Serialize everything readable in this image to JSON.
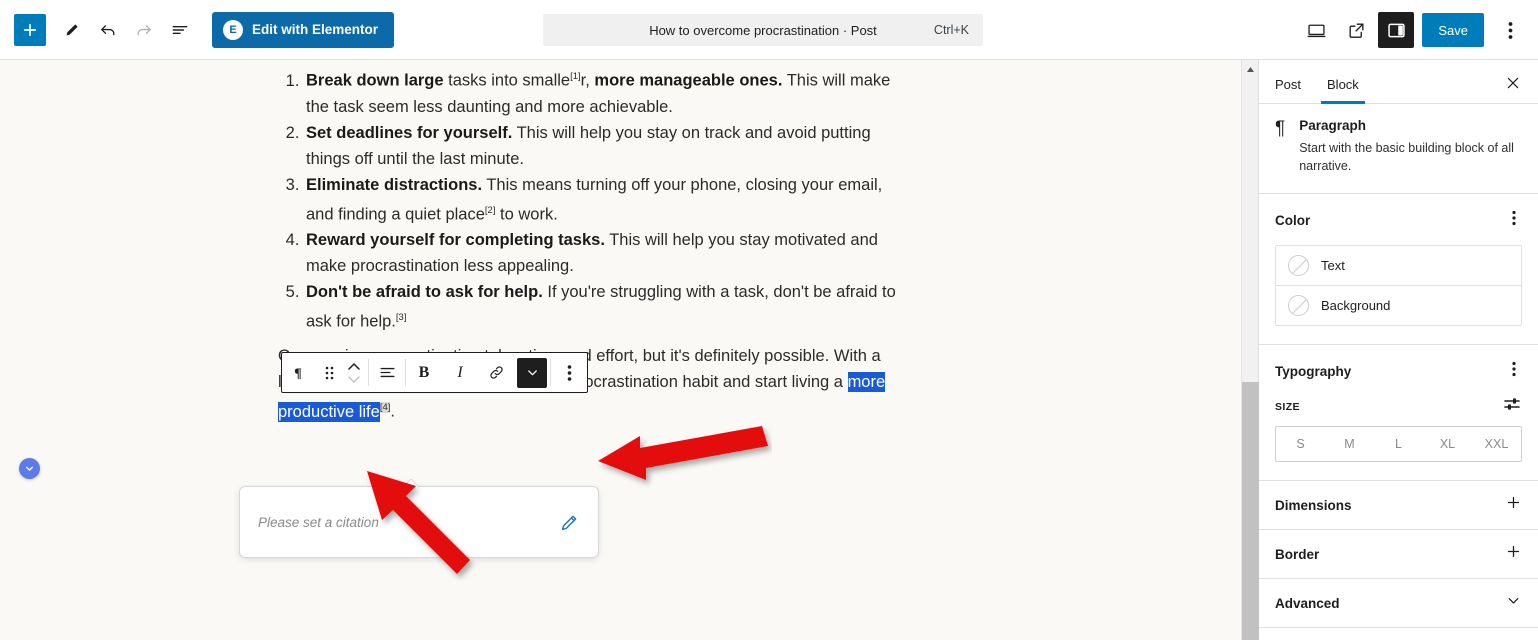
{
  "topbar": {
    "add_block_label": "+",
    "tools_icon": "pencil-icon",
    "undo_icon": "undo-icon",
    "redo_icon": "redo-icon",
    "list_view_icon": "list-view-icon",
    "elementor_badge": "E",
    "elementor_label": "Edit with Elementor",
    "document_title": "How to overcome procrastination · Post",
    "shortcut": "Ctrl+K",
    "preview_icon": "desktop-icon",
    "view_icon": "external-link-icon",
    "settings_panel_icon": "sidebar-panel-icon",
    "save_label": "Save",
    "options_icon": "more-vertical-icon",
    "accent_blue": "#007cba",
    "elementor_blue": "#0d6aa8"
  },
  "editor": {
    "list_items": [
      {
        "num": "1.",
        "bold": "Break down large",
        "mid": " tasks into smalle",
        "cite": "[1]",
        "mid2": "r, ",
        "bold2": "more manageable ones.",
        "rest": " This will make the task seem less daunting and more achievable."
      },
      {
        "num": "2.",
        "bold": "Set deadlines for yourself.",
        "rest": " This will help you stay on track and avoid putting things off until the last minute."
      },
      {
        "num": "3.",
        "bold": "Eliminate distractions.",
        "mid": " This means turning off your phone, closing your email, and finding a quiet place",
        "cite": "[2]",
        "rest": " to work."
      },
      {
        "num": "4.",
        "bold": "Reward yourself for completing tasks.",
        "rest": " This will help you stay motivated and make procrastination less appealing."
      },
      {
        "num": "5.",
        "bold": "Don't be afraid to ask for help.",
        "mid": " If you're struggling with a task, don't be afraid to ask for help.",
        "cite": "[3]",
        "rest": ""
      }
    ],
    "closing_pre": "Overcoming procrastination takes time and effort, but it's definitely possible. With a little bit of hard work, you can break the procrastination habit and start living a ",
    "closing_selected": "more productive life",
    "closing_cite": "[4]",
    "closing_post": ".",
    "selection_color": "#1a5ad7"
  },
  "block_toolbar": {
    "paragraph_icon": "paragraph-icon",
    "drag_icon": "drag-handle-icon",
    "move_icon": "move-up-down-icon",
    "align_icon": "align-text-icon",
    "bold_label": "B",
    "italic_label": "I",
    "link_icon": "link-icon",
    "more_formats_icon": "chevron-down-icon",
    "options_icon": "more-vertical-icon"
  },
  "citation_popover": {
    "placeholder": "Please set a citation",
    "edit_icon": "pencil-edit-icon",
    "edit_icon_color": "#1a73c8"
  },
  "float_button": {
    "icon": "chevron-down-icon",
    "color": "#5b7ce8"
  },
  "scrollbar": {
    "up_arrow_icon": "triangle-up-icon"
  },
  "sidebar": {
    "tabs": [
      {
        "label": "Post",
        "active": false
      },
      {
        "label": "Block",
        "active": true
      }
    ],
    "close_icon": "close-icon",
    "block_card": {
      "icon": "paragraph-icon",
      "title": "Paragraph",
      "description": "Start with the basic building block of all narrative."
    },
    "color_section": {
      "title": "Color",
      "kebab_icon": "more-vertical-icon",
      "rows": [
        {
          "label": "Text",
          "swatch": "none-slash-icon"
        },
        {
          "label": "Background",
          "swatch": "none-slash-icon"
        }
      ]
    },
    "typography_section": {
      "title": "Typography",
      "kebab_icon": "more-vertical-icon",
      "size_label": "SIZE",
      "size_settings_icon": "sliders-icon",
      "sizes": [
        "S",
        "M",
        "L",
        "XL",
        "XXL"
      ]
    },
    "accordions": [
      {
        "label": "Dimensions",
        "icon": "plus-icon"
      },
      {
        "label": "Border",
        "icon": "plus-icon"
      },
      {
        "label": "Advanced",
        "icon": "chevron-down-icon"
      }
    ]
  },
  "annotations": {
    "arrow_color": "#e41111",
    "arrows": [
      {
        "name": "arrow-pointing-at-edit-icon"
      },
      {
        "name": "arrow-pointing-at-citation-field"
      }
    ]
  }
}
